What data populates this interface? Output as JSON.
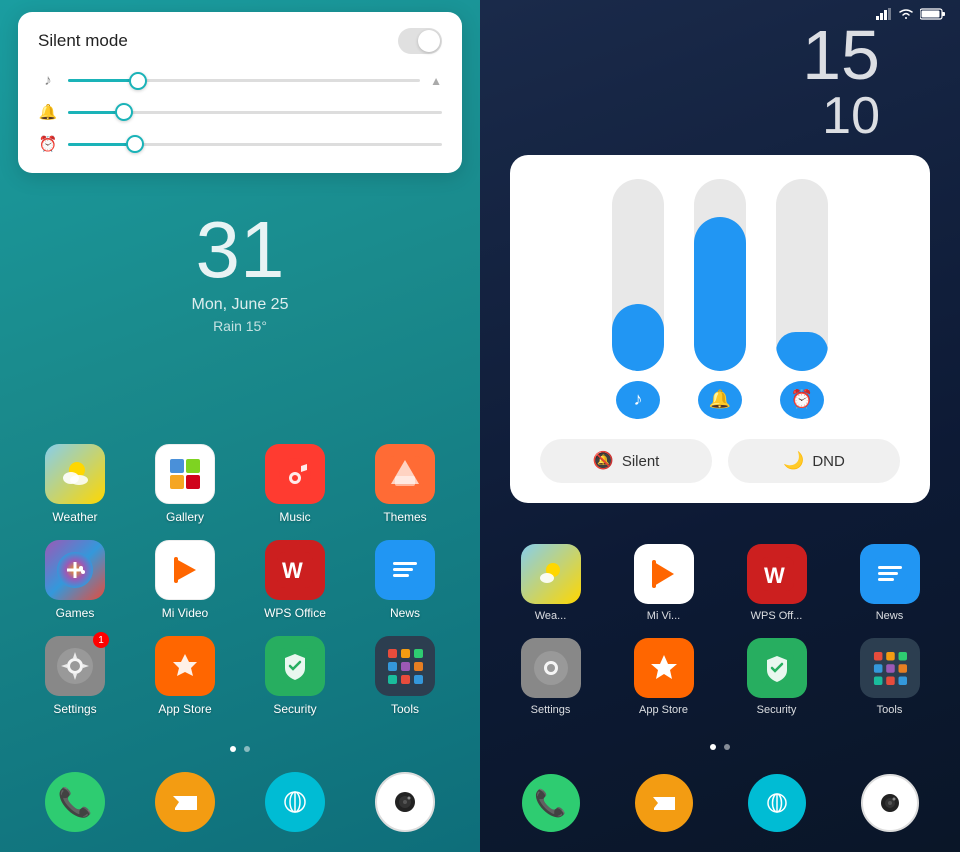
{
  "left": {
    "volume_popup": {
      "title": "Silent mode",
      "toggle_state": "off",
      "sliders": [
        {
          "icon": "♪",
          "fill": 20,
          "thumb": 20,
          "id": "media"
        },
        {
          "icon": "🔔",
          "fill": 15,
          "thumb": 15,
          "id": "ring"
        },
        {
          "icon": "⏰",
          "fill": 18,
          "thumb": 18,
          "id": "alarm"
        }
      ]
    },
    "date": "31",
    "date_sub": "Mon, June 25",
    "weather": "Rain  15°",
    "apps_row1": [
      {
        "label": "Weather",
        "icon": "weather",
        "color": "ic-weather"
      },
      {
        "label": "Gallery",
        "icon": "gallery",
        "color": "ic-gallery"
      },
      {
        "label": "Music",
        "icon": "music",
        "color": "ic-music"
      },
      {
        "label": "Themes",
        "icon": "themes",
        "color": "ic-themes"
      }
    ],
    "apps_row2": [
      {
        "label": "Games",
        "icon": "games",
        "color": "ic-games"
      },
      {
        "label": "Mi Video",
        "icon": "mivideo",
        "color": "ic-mivideo"
      },
      {
        "label": "WPS Office",
        "icon": "wps",
        "color": "ic-wps"
      },
      {
        "label": "News",
        "icon": "news",
        "color": "ic-news"
      }
    ],
    "apps_row3": [
      {
        "label": "Settings",
        "icon": "settings",
        "color": "ic-settings",
        "badge": "1"
      },
      {
        "label": "App Store",
        "icon": "appstore",
        "color": "ic-appstore"
      },
      {
        "label": "Security",
        "icon": "security",
        "color": "ic-security"
      },
      {
        "label": "Tools",
        "icon": "tools",
        "color": "ic-tools"
      }
    ],
    "dock": [
      {
        "label": "Phone",
        "color": "dock-phone",
        "icon": "📞"
      },
      {
        "label": "Messages",
        "color": "dock-msg",
        "icon": "💬"
      },
      {
        "label": "Browser",
        "color": "dock-browser",
        "icon": "🌐"
      },
      {
        "label": "Camera",
        "color": "dock-camera",
        "icon": "⊙"
      }
    ]
  },
  "right": {
    "time_hour": "15",
    "time_min": "10",
    "volume_sliders": [
      {
        "id": "media",
        "icon": "♪",
        "fill_pct": 35
      },
      {
        "id": "ring",
        "icon": "🔔",
        "fill_pct": 80
      },
      {
        "id": "alarm",
        "icon": "⏰",
        "fill_pct": 20
      }
    ],
    "silent_btn": "Silent",
    "dnd_btn": "DND",
    "apps_row1_labels": [
      "Wea...",
      "Mi Vi...",
      "WPS Off...",
      "News"
    ],
    "apps_row2_labels": [
      "Settings",
      "App Store",
      "Security",
      "Tools"
    ],
    "dock": [
      {
        "label": "Phone",
        "color": "dock-phone",
        "icon": "📞"
      },
      {
        "label": "Messages",
        "color": "dock-msg",
        "icon": "💬"
      },
      {
        "label": "Browser",
        "color": "dock-browser",
        "icon": "🌐"
      },
      {
        "label": "Camera",
        "color": "dock-camera",
        "icon": "⊙"
      }
    ]
  }
}
